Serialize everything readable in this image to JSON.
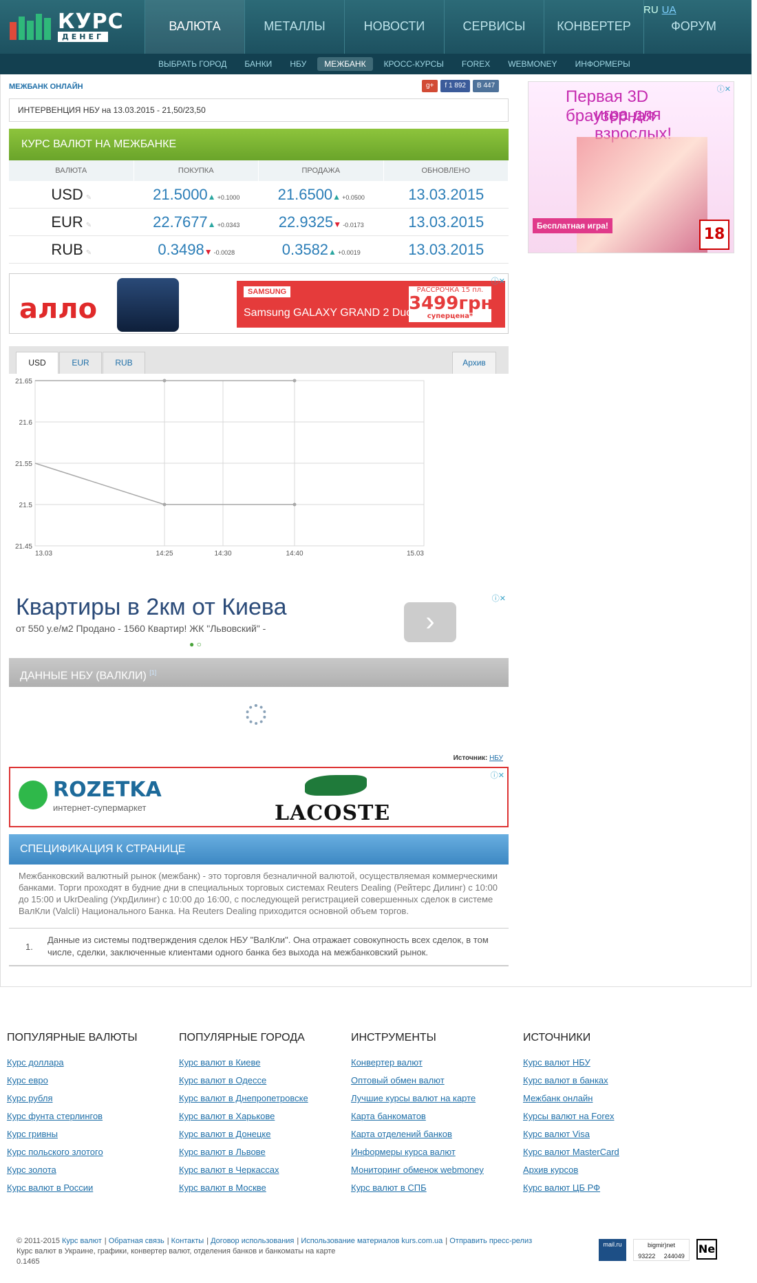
{
  "header": {
    "logo_word": "КУРС",
    "logo_sub": "ДЕНЕГ",
    "nav": [
      "ВАЛЮТА",
      "МЕТАЛЛЫ",
      "НОВОСТИ",
      "СЕРВИСЫ",
      "КОНВЕРТЕР",
      "ФОРУМ"
    ],
    "active_nav": "ВАЛЮТА",
    "lang_ru": "RU",
    "lang_ua": "UA",
    "subnav": [
      "ВЫБРАТЬ ГОРОД",
      "БАНКИ",
      "НБУ",
      "МЕЖБАНК",
      "КРОСС-КУРСЫ",
      "FOREX",
      "WEBMONEY",
      "ИНФОРМЕРЫ"
    ],
    "active_sub": "МЕЖБАНК"
  },
  "main": {
    "section_label": "МЕЖБАНК ОНЛАЙН",
    "share": {
      "gplus": "g+",
      "fb": "f 1 892",
      "vk": "В 447"
    },
    "intervention": "ИНТЕРВЕНЦИЯ НБУ на 13.03.2015 - 21,50/23,50",
    "rates_title": "КУРС ВАЛЮТ НА МЕЖБАНКЕ",
    "rates_header": [
      "ВАЛЮТА",
      "ПОКУПКА",
      "ПРОДАЖА",
      "ОБНОВЛЕНО"
    ],
    "rates": [
      {
        "currency": "USD",
        "buy": "21.5000",
        "buy_dir": "up",
        "buy_delta": "+0.1000",
        "sell": "21.6500",
        "sell_dir": "up",
        "sell_delta": "+0.0500",
        "updated": "13.03.2015"
      },
      {
        "currency": "EUR",
        "buy": "22.7677",
        "buy_dir": "up",
        "buy_delta": "+0.0343",
        "sell": "22.9325",
        "sell_dir": "down",
        "sell_delta": "-0.0173",
        "updated": "13.03.2015"
      },
      {
        "currency": "RUB",
        "buy": "0.3498",
        "buy_dir": "down",
        "buy_delta": "-0.0028",
        "sell": "0.3582",
        "sell_dir": "up",
        "sell_delta": "+0.0019",
        "updated": "13.03.2015"
      }
    ],
    "ad1": {
      "brand": "алло",
      "promo_brand": "SAMSUNG",
      "product": "Samsung GALAXY GRAND 2 Duos",
      "price": "3499грн",
      "note": "суперцена*",
      "install": "РАССРОЧКА 15 пл."
    },
    "chart_tabs": [
      "USD",
      "EUR",
      "RUB"
    ],
    "active_chart_tab": "USD",
    "archive_label": "Архив",
    "ad2": {
      "title": "Квартиры в 2км от Киева",
      "sub": "от 550 у.е/м2 Продано - 1560 Квартир! ЖК \"Львовский\" -",
      "button": "›"
    },
    "nbu_title": "ДАННЫЕ НБУ (ВАЛКЛИ)",
    "nbu_sup": "[1]",
    "source_label": "Источник:",
    "source_link": "НБУ",
    "ad3": {
      "roz_name": "ROZETKA",
      "roz_sub": "интернет-супермаркет",
      "brand": "LACOSTE"
    },
    "spec_title": "СПЕЦИФИКАЦИЯ К СТРАНИЦЕ",
    "spec_text": "Межбанковский валютный рынок (межбанк) - это торговля безналичной валютой, осуществляемая коммерческими банками. Торги проходят в будние дни в специальных торговых системах Reuters Dealing (Рейтерс Дилинг) с 10:00 до 15:00 и UkrDealing (УкрДилинг) с 10:00 до 16:00, с последующей регистрацией совершенных сделок в системе ВалКли (Valcli) Национального Банка. На Reuters Dealing приходится основной объем торгов.",
    "footnote_num": "1.",
    "footnote": "Данные из системы подтверждения сделок НБУ \"ВалКли\". Она отражает совокупность всех сделок, в том числе, сделки, заключенные клиентами одного банка без выхода на межбанковский рынок."
  },
  "side_ad": {
    "line1": "Первая 3D браузерная",
    "line2": "игра для взрослых!",
    "badge": "Бесплатная игра!",
    "age": "18"
  },
  "footer": {
    "cols": [
      {
        "title": "ПОПУЛЯРНЫЕ ВАЛЮТЫ",
        "links": [
          "Курс доллара",
          "Курс евро",
          "Курс рубля",
          "Курс фунта стерлингов",
          "Курс гривны",
          "Курс польского злотого",
          "Курс золота",
          "Курс валют в России"
        ]
      },
      {
        "title": "ПОПУЛЯРНЫЕ ГОРОДА",
        "links": [
          "Курс валют в Киеве",
          "Курс валют в Одессе",
          "Курс валют в Днепропетровске",
          "Курс валют в Харькове",
          "Курс валют в Донецке",
          "Курс валют в Львове",
          "Курс валют в Черкассах",
          "Курс валют в Москве"
        ]
      },
      {
        "title": "ИНСТРУМЕНТЫ",
        "links": [
          "Конвертер валют",
          "Оптовый обмен валют",
          "Лучшие курсы валют на карте",
          "Карта банкоматов",
          "Карта отделений банков",
          "Информеры курса валют",
          "Мониторинг обменок webmoney",
          "Курс валют в СПБ"
        ]
      },
      {
        "title": "ИСТОЧНИКИ",
        "links": [
          "Курс валют НБУ",
          "Курс валют в банках",
          "Межбанк онлайн",
          "Курсы валют на Forex",
          "Курс валют Visa",
          "Курс валют MasterCard",
          "Архив курсов",
          "Курс валют ЦБ РФ"
        ]
      }
    ],
    "copyright": "© 2011-2015",
    "bottom_links": [
      "Курс валют",
      "Обратная связь",
      "Контакты",
      "Договор использования",
      "Использование материалов kurs.com.ua",
      "Отправить пресс-релиз"
    ],
    "tagline": "Курс валют в Украине, графики, конвертер валют, отделения банков и банкоматы на карте",
    "version": "0.1465",
    "counters": {
      "mail": "mail.ru",
      "bigmir": "bigmir)net",
      "bigmir_a": "93222",
      "bigmir_b": "244049",
      "ne": "Ne"
    }
  },
  "chart_data": {
    "type": "line",
    "x": [
      "13.03",
      "14:25",
      "14:30",
      "14:40",
      "15.03"
    ],
    "ylim": [
      21.45,
      21.65
    ],
    "yticks": [
      "21.65",
      "21.6",
      "21.55",
      "21.5",
      "21.45"
    ],
    "grid": true,
    "series": [
      {
        "values": [
          {
            "x": "13.03",
            "y": 21.65
          },
          {
            "x": "14:25",
            "y": 21.65
          },
          {
            "x": "14:40",
            "y": 21.65
          }
        ]
      },
      {
        "values": [
          {
            "x": "13.03",
            "y": 21.55
          },
          {
            "x": "14:25",
            "y": 21.5
          },
          {
            "x": "14:40",
            "y": 21.5
          }
        ]
      }
    ],
    "colors": {
      "line": "#a8a8a8",
      "grid": "#d8d8d8"
    }
  }
}
